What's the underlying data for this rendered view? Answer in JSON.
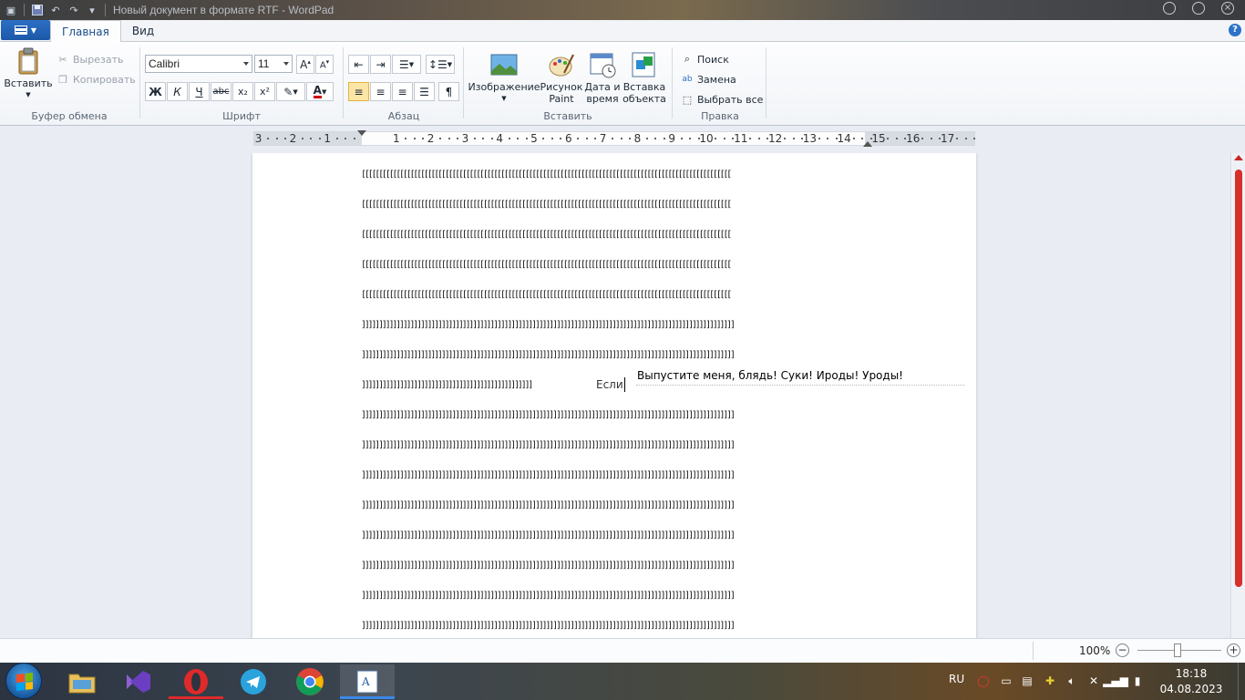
{
  "window": {
    "title": "Новый документ в формате RTF - WordPad",
    "controls": [
      "minimize",
      "maximize",
      "close"
    ]
  },
  "ribbon_tabs": [
    {
      "label": "Главная",
      "active": true
    },
    {
      "label": "Вид",
      "active": false
    }
  ],
  "clipboard": {
    "paste_label": "Вставить",
    "cut_label": "Вырезать",
    "copy_label": "Копировать",
    "group_label": "Буфер обмена"
  },
  "font": {
    "family": "Calibri",
    "size": "11",
    "group_label": "Шрифт",
    "buttons": [
      "Ж",
      "К",
      "Ч",
      "abc",
      "x₂",
      "x²"
    ]
  },
  "paragraph": {
    "group_label": "Абзац",
    "alignment": "left"
  },
  "insert": {
    "group_label": "Вставить",
    "image_label": "Изображение",
    "paint_label_1": "Рисунок",
    "paint_label_2": "Paint",
    "datetime_label_1": "Дата и",
    "datetime_label_2": "время",
    "object_label_1": "Вставка",
    "object_label_2": "объекта"
  },
  "editing": {
    "group_label": "Правка",
    "find_label": "Поиск",
    "replace_label": "Замена",
    "select_all_label": "Выбрать все"
  },
  "ruler": {
    "numbers": [
      "3",
      "2",
      "1",
      "1",
      "2",
      "3",
      "4",
      "5",
      "6",
      "7",
      "8",
      "9",
      "10",
      "11",
      "12",
      "13",
      "14",
      "15",
      "16",
      "17"
    ]
  },
  "document": {
    "lines": [
      "[[[[[[[[[[[[[[[[[[[[[[[[[[[[[[[[[[[[[[[[[[[[[[[[[[[[[[[[[[[[[[[[[[[[[[[[[[[[[[[[[[[[[[[[[[[[[[[[[[[[[[[[[[",
      "[[[[[[[[[[[[[[[[[[[[[[[[[[[[[[[[[[[[[[[[[[[[[[[[[[[[[[[[[[[[[[[[[[[[[[[[[[[[[[[[[[[[[[[[[[[[[[[[[[[[[[[[[[",
      "[[[[[[[[[[[[[[[[[[[[[[[[[[[[[[[[[[[[[[[[[[[[[[[[[[[[[[[[[[[[[[[[[[[[[[[[[[[[[[[[[[[[[[[[[[[[[[[[[[[[[[[[[[",
      "[[[[[[[[[[[[[[[[[[[[[[[[[[[[[[[[[[[[[[[[[[[[[[[[[[[[[[[[[[[[[[[[[[[[[[[[[[[[[[[[[[[[[[[[[[[[[[[[[[[[[[[[[[",
      "[[[[[[[[[[[[[[[[[[[[[[[[[[[[[[[[[[[[[[[[[[[[[[[[[[[[[[[[[[[[[[[[[[[[[[[[[[[[[[[[[[[[[[[[[[[[[[[[[[[[[[[[[[",
      "]]]]]]]]]]]]]]]]]]]]]]]]]]]]]]]]]]]]]]]]]]]]]]]]]]]]]]]]]]]]]]]]]]]]]]]]]]]]]]]]]]]]]]]]]]]]]]]]]]]]]]]]]]]",
      "]]]]]]]]]]]]]]]]]]]]]]]]]]]]]]]]]]]]]]]]]]]]]]]]]]]]]]]]]]]]]]]]]]]]]]]]]]]]]]]]]]]]]]]]]]]]]]]]]]]]]]]]]]]",
      "]]]]]]]]]]]]]]]]]]]]]]]]]]]]]]]]]]]]]]]]]]]]]]]]]",
      "]]]]]]]]]]]]]]]]]]]]]]]]]]]]]]]]]]]]]]]]]]]]]]]]]]]]]]]]]]]]]]]]]]]]]]]]]]]]]]]]]]]]]]]]]]]]]]]]]]]]]]]]]]]",
      "]]]]]]]]]]]]]]]]]]]]]]]]]]]]]]]]]]]]]]]]]]]]]]]]]]]]]]]]]]]]]]]]]]]]]]]]]]]]]]]]]]]]]]]]]]]]]]]]]]]]]]]]]]]",
      "]]]]]]]]]]]]]]]]]]]]]]]]]]]]]]]]]]]]]]]]]]]]]]]]]]]]]]]]]]]]]]]]]]]]]]]]]]]]]]]]]]]]]]]]]]]]]]]]]]]]]]]]]]]",
      "]]]]]]]]]]]]]]]]]]]]]]]]]]]]]]]]]]]]]]]]]]]]]]]]]]]]]]]]]]]]]]]]]]]]]]]]]]]]]]]]]]]]]]]]]]]]]]]]]]]]]]]]]]]",
      "]]]]]]]]]]]]]]]]]]]]]]]]]]]]]]]]]]]]]]]]]]]]]]]]]]]]]]]]]]]]]]]]]]]]]]]]]]]]]]]]]]]]]]]]]]]]]]]]]]]]]]]]]]]",
      "]]]]]]]]]]]]]]]]]]]]]]]]]]]]]]]]]]]]]]]]]]]]]]]]]]]]]]]]]]]]]]]]]]]]]]]]]]]]]]]]]]]]]]]]]]]]]]]]]]]]]]]]]]]",
      "]]]]]]]]]]]]]]]]]]]]]]]]]]]]]]]]]]]]]]]]]]]]]]]]]]]]]]]]]]]]]]]]]]]]]]]]]]]]]]]]]]]]]]]]]]]]]]]]]]]]]]]]]]]",
      "]]]]]]]]]]]]]]]]]]]]]]]]]]]]]]]]]]]]]]]]]]]]]]]]]]]]]]]]]]]]]]]]]]]]]]]]]]]]]]]]]]]]]]]]]]]]]]]]]]]]]]]]]]]"
    ],
    "typed_word": "Если",
    "ime_suggestion": "Выпустите меня, блядь! Суки! Ироды! Уроды!"
  },
  "status": {
    "zoom": "100%",
    "zoom_minus": "−",
    "zoom_plus": "+"
  },
  "taskbar": {
    "apps": [
      "file-explorer",
      "visual-studio",
      "opera",
      "telegram",
      "chrome",
      "wordpad"
    ],
    "language": "RU",
    "time": "18:18",
    "date": "04.08.2023"
  },
  "colors": {
    "accent": "#1c58a8",
    "scrollbar": "#d6302b",
    "active_button": "#fce5a5"
  }
}
